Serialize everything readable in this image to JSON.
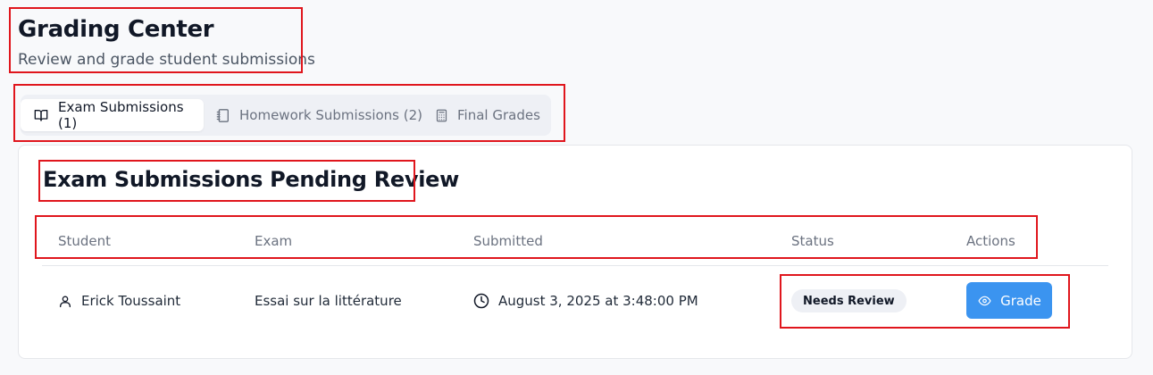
{
  "header": {
    "title": "Grading Center",
    "subtitle": "Review and grade student submissions"
  },
  "tabs": [
    {
      "label": "Exam Submissions (1)",
      "icon": "book-open-icon",
      "active": true
    },
    {
      "label": "Homework Submissions (2)",
      "icon": "notebook-icon",
      "active": false
    },
    {
      "label": "Final Grades",
      "icon": "calculator-icon",
      "active": false
    }
  ],
  "section": {
    "title": "Exam Submissions Pending Review"
  },
  "table": {
    "columns": [
      "Student",
      "Exam",
      "Submitted",
      "Status",
      "Actions"
    ],
    "rows": [
      {
        "student": "Erick Toussaint",
        "exam": "Essai sur la littérature",
        "submitted": "August 3, 2025 at 3:48:00 PM",
        "status": "Needs Review",
        "action": "Grade"
      }
    ]
  },
  "colors": {
    "accent": "#3b94f0",
    "highlight_box": "#e0161d",
    "badge_bg": "#eef0f5"
  }
}
